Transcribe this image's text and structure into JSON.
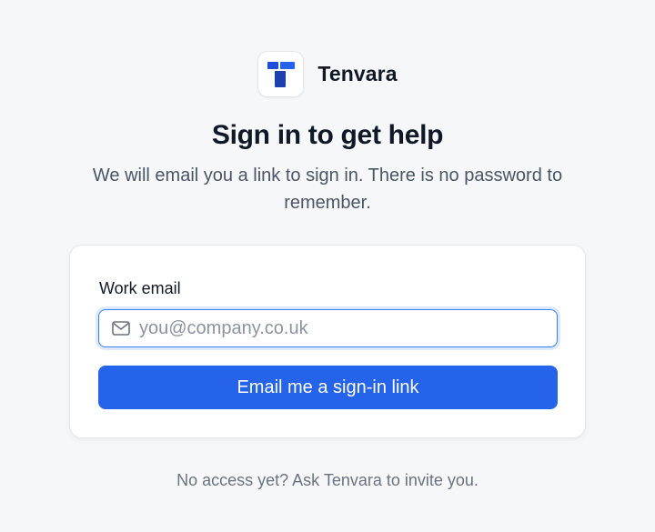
{
  "brand": {
    "name": "Tenvara",
    "logo_icon": "tenvara-t-logo",
    "accent_color": "#1d4ed8"
  },
  "header": {
    "title": "Sign in to get help",
    "subtitle": "We will email you a link to sign in. There is no password to remember."
  },
  "form": {
    "email_label": "Work email",
    "email_icon": "mail-icon",
    "email_value": "",
    "email_placeholder": "you@company.co.uk",
    "submit_label": "Email me a sign-in link",
    "primary_color": "#2563eb"
  },
  "footer": {
    "text": "No access yet? Ask Tenvara to invite you."
  }
}
